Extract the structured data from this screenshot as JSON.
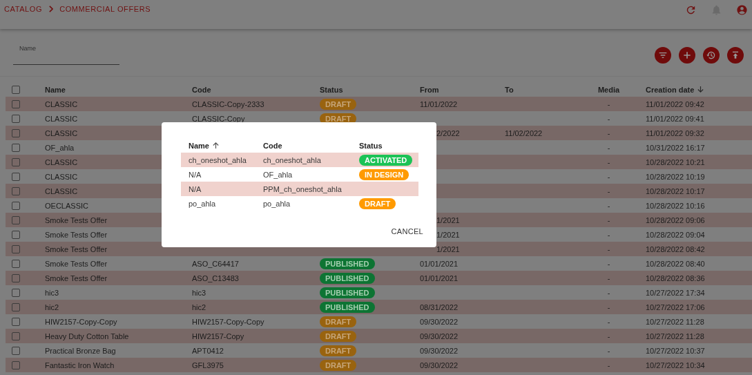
{
  "breadcrumb": [
    "CATALOG",
    "COMMERCIAL OFFERS"
  ],
  "filter": {
    "name_field": {
      "label": "Name"
    }
  },
  "table": {
    "all_selected": false,
    "columns": [
      {
        "label": "Name"
      },
      {
        "label": "Code"
      },
      {
        "label": "Status"
      },
      {
        "label": "From"
      },
      {
        "label": "To"
      },
      {
        "label": "Media"
      },
      {
        "label": "Creation date",
        "sorted_descending": true
      }
    ],
    "rows": [
      {
        "selected": false,
        "name": "CLASSIC",
        "code": "CLASSIC-Copy-2333",
        "status": {
          "label": "DRAFT",
          "kind": "draft"
        },
        "from": "11/01/2022",
        "media": "-",
        "created": "11/01/2022 09:42"
      },
      {
        "selected": false,
        "name": "CLASSIC",
        "code": "CLASSIC-Copy",
        "status": {
          "label": "DRAFT",
          "kind": "draft"
        },
        "media": "-",
        "created": "11/01/2022 09:41"
      },
      {
        "selected": false,
        "name": "CLASSIC",
        "from": "2/2022",
        "from_cut": true,
        "to": "11/02/2022",
        "media": "-",
        "created": "11/01/2022 09:32"
      },
      {
        "selected": false,
        "name": "OF_ahla",
        "media": "-",
        "created": "10/31/2022 16:17"
      },
      {
        "selected": false,
        "name": "CLASSIC",
        "media": "-",
        "created": "10/28/2022 10:21"
      },
      {
        "selected": false,
        "name": "CLASSIC",
        "media": "-",
        "created": "10/28/2022 10:19"
      },
      {
        "selected": false,
        "name": "CLASSIC",
        "media": "-",
        "created": "10/28/2022 10:17"
      },
      {
        "selected": false,
        "name": "OECLASSIC",
        "media": "-",
        "created": "10/28/2022 10:16"
      },
      {
        "selected": false,
        "name": "Smoke Tests Offer",
        "from": "1/2021",
        "from_cut": true,
        "media": "-",
        "created": "10/28/2022 09:06"
      },
      {
        "selected": false,
        "name": "Smoke Tests Offer",
        "from": "1/2021",
        "from_cut": true,
        "media": "-",
        "created": "10/28/2022 09:04"
      },
      {
        "selected": false,
        "name": "Smoke Tests Offer",
        "from": "1/2021",
        "from_cut": true,
        "media": "-",
        "created": "10/28/2022 08:42"
      },
      {
        "selected": false,
        "name": "Smoke Tests Offer",
        "code": "ASO_C64417",
        "status": {
          "label": "PUBLISHED",
          "kind": "published"
        },
        "from": "01/01/2021",
        "media": "-",
        "created": "10/28/2022 08:40"
      },
      {
        "selected": false,
        "name": "Smoke Tests Offer",
        "code": "ASO_C13483",
        "status": {
          "label": "PUBLISHED",
          "kind": "published"
        },
        "from": "01/01/2021",
        "media": "-",
        "created": "10/28/2022 08:36"
      },
      {
        "selected": false,
        "name": "hic3",
        "code": "hic3",
        "status": {
          "label": "PUBLISHED",
          "kind": "published"
        },
        "media": "-",
        "created": "10/27/2022 17:34"
      },
      {
        "selected": false,
        "name": "hic2",
        "code": "hic2",
        "status": {
          "label": "PUBLISHED",
          "kind": "published"
        },
        "from": "08/31/2022",
        "media": "-",
        "created": "10/27/2022 17:06"
      },
      {
        "selected": false,
        "name": "HIW2157-Copy-Copy",
        "code": "HIW2157-Copy-Copy",
        "status": {
          "label": "DRAFT",
          "kind": "draft"
        },
        "from": "09/30/2022",
        "media": "-",
        "created": "10/27/2022 11:28"
      },
      {
        "selected": false,
        "name": "Heavy Duty Cotton Table",
        "code": "HIW2157-Copy",
        "status": {
          "label": "DRAFT",
          "kind": "draft"
        },
        "from": "09/30/2022",
        "media": "-",
        "created": "10/27/2022 11:28"
      },
      {
        "selected": false,
        "name": "Practical Bronze Bag",
        "code": "APT0412",
        "status": {
          "label": "DRAFT",
          "kind": "draft"
        },
        "from": "09/30/2022",
        "media": "-",
        "created": "10/27/2022 10:37"
      },
      {
        "selected": false,
        "name": "Fantastic Iron Watch",
        "code": "GFL3975",
        "status": {
          "label": "DRAFT",
          "kind": "draft"
        },
        "from": "09/30/2022",
        "media": "-",
        "created": "10/27/2022 10:34"
      }
    ]
  },
  "dialog": {
    "columns": [
      {
        "label": "Name",
        "sorted_ascending": true
      },
      {
        "label": "Code"
      },
      {
        "label": "Status"
      }
    ],
    "rows": [
      {
        "name": "ch_oneshot_ahla",
        "code": "ch_oneshot_ahla",
        "status": {
          "label": "ACTIVATED",
          "kind": "activated"
        }
      },
      {
        "name": "N/A",
        "code": "OF_ahla",
        "status": {
          "label": "IN DESIGN",
          "kind": "in_design"
        }
      },
      {
        "name": "N/A",
        "code": "PPM_ch_oneshot_ahla"
      },
      {
        "name": "po_ahla",
        "code": "po_ahla",
        "status": {
          "label": "DRAFT",
          "kind": "draft"
        }
      }
    ],
    "cancel": "CANCEL"
  }
}
